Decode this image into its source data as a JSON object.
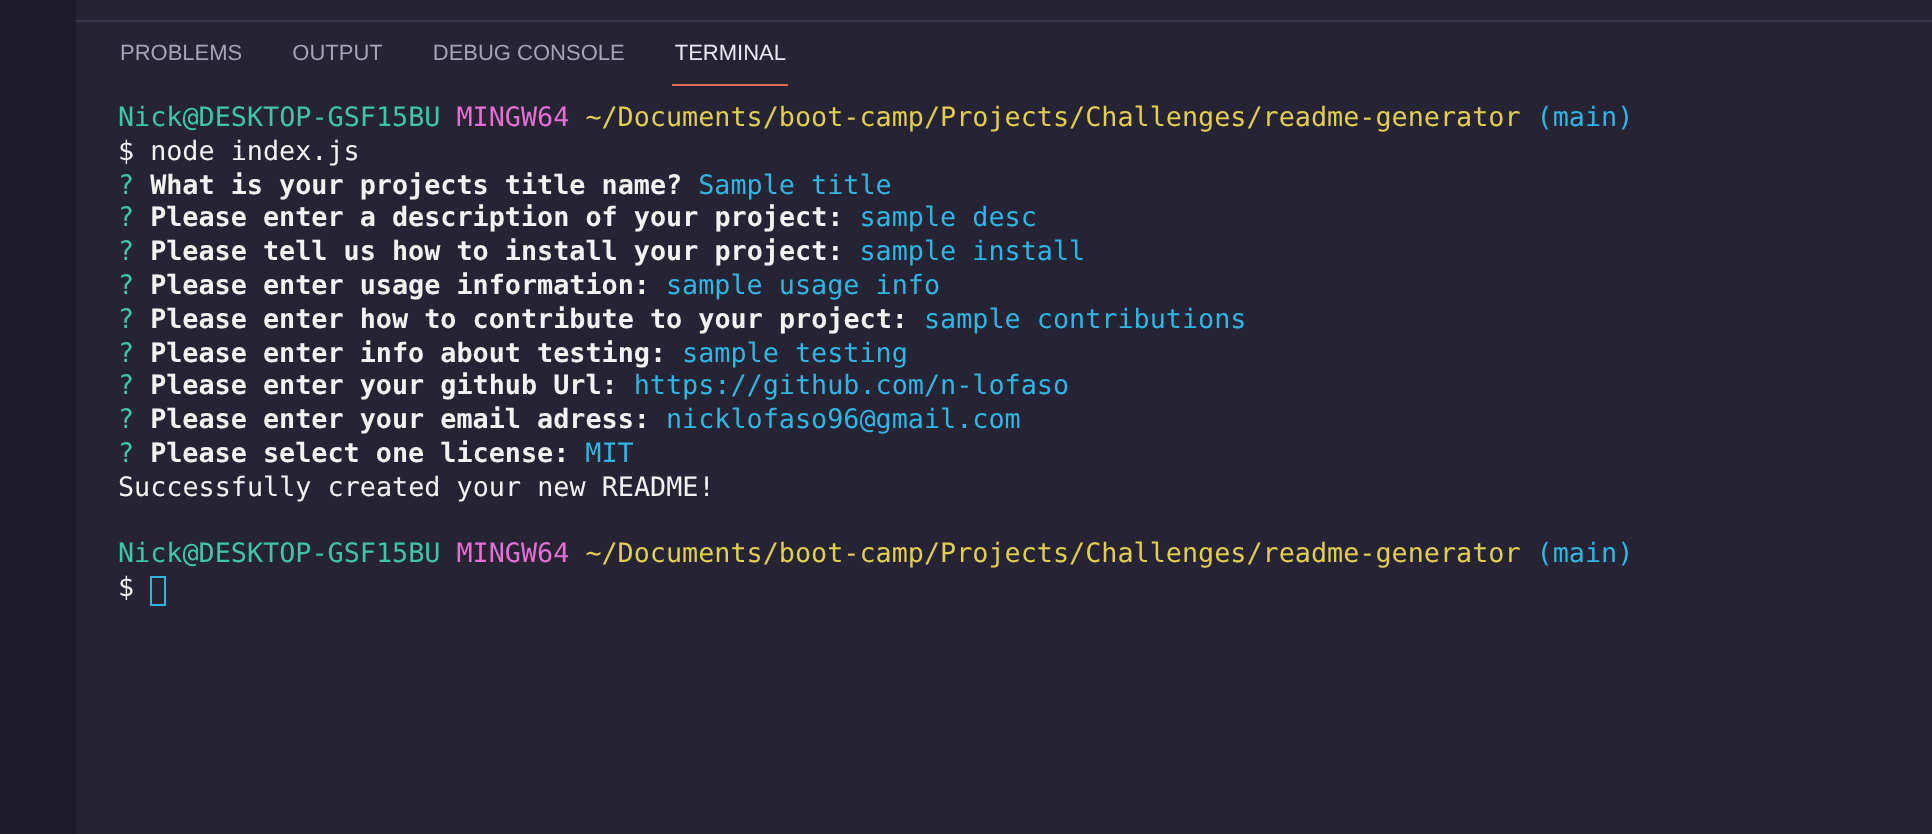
{
  "tabs": [
    {
      "label": "PROBLEMS",
      "selected": false
    },
    {
      "label": "OUTPUT",
      "selected": false
    },
    {
      "label": "DEBUG CONSOLE",
      "selected": false
    },
    {
      "label": "TERMINAL",
      "selected": true
    }
  ],
  "terminal": {
    "lines": [
      {
        "kind": "prompt",
        "user": "Nick@DESKTOP-GSF15BU",
        "system": "MINGW64",
        "path": "~/Documents/boot-camp/Projects/Challenges/readme-generator",
        "branch": "(main)"
      },
      {
        "kind": "command",
        "symbol": "$",
        "text": "node index.js"
      },
      {
        "kind": "question",
        "mark": "?",
        "question": "What is your projects title name?",
        "answer": "Sample title"
      },
      {
        "kind": "question",
        "mark": "?",
        "question": "Please enter a description of your project:",
        "answer": "sample desc"
      },
      {
        "kind": "question",
        "mark": "?",
        "question": "Please tell us how to install your project:",
        "answer": "sample install"
      },
      {
        "kind": "question",
        "mark": "?",
        "question": "Please enter usage information:",
        "answer": "sample usage info"
      },
      {
        "kind": "question",
        "mark": "?",
        "question": "Please enter how to contribute to your project:",
        "answer": "sample contributions"
      },
      {
        "kind": "question",
        "mark": "?",
        "question": "Please enter info about testing:",
        "answer": "sample testing"
      },
      {
        "kind": "question",
        "mark": "?",
        "question": "Please enter your github Url:",
        "answer": "https://github.com/n-lofaso"
      },
      {
        "kind": "question",
        "mark": "?",
        "question": "Please enter your email adress:",
        "answer": "nicklofaso96@gmail.com"
      },
      {
        "kind": "question",
        "mark": "?",
        "question": "Please select one license:",
        "answer": "MIT"
      },
      {
        "kind": "output",
        "text": "Successfully created your new README!"
      },
      {
        "kind": "blank"
      },
      {
        "kind": "prompt",
        "user": "Nick@DESKTOP-GSF15BU",
        "system": "MINGW64",
        "path": "~/Documents/boot-camp/Projects/Challenges/readme-generator",
        "branch": "(main)"
      },
      {
        "kind": "input",
        "symbol": "$",
        "cursor": true
      }
    ]
  }
}
